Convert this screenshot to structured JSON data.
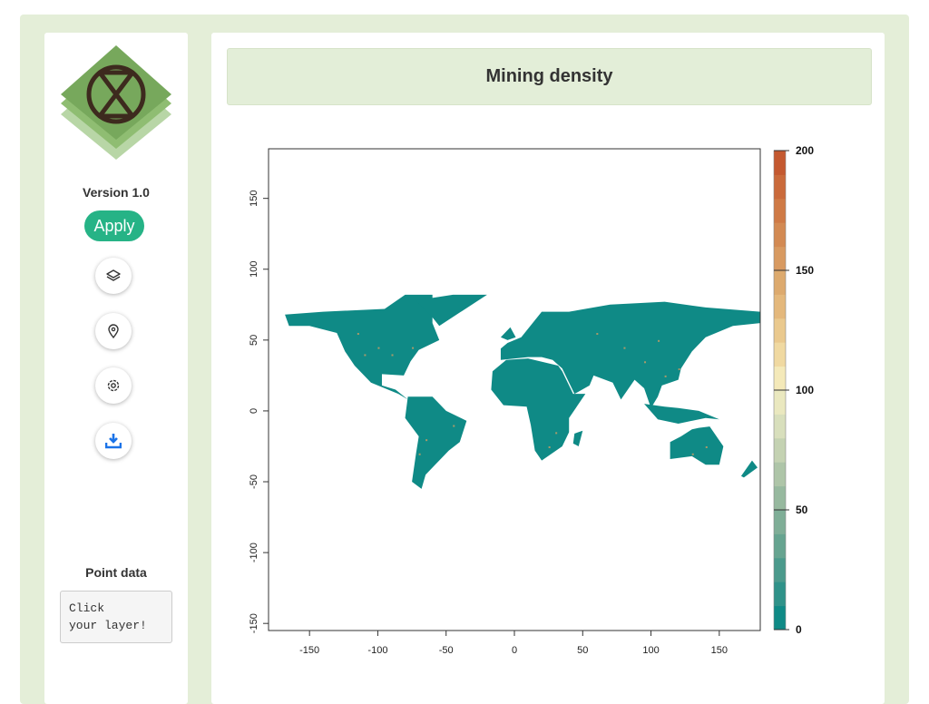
{
  "sidebar": {
    "version": "Version 1.0",
    "apply_label": "Apply",
    "icons": [
      "layers-icon",
      "map-pin-icon",
      "gear-icon",
      "download-icon"
    ],
    "point_data_title": "Point data",
    "point_data_text": "Click\nyour layer!"
  },
  "header": {
    "title": "Mining density"
  },
  "colors": {
    "accent": "#26b386",
    "land": "#0f8a86",
    "bg": "#e4eed8"
  },
  "chart_data": {
    "type": "heatmap",
    "title": "Mining density",
    "xlim": [
      -180,
      180
    ],
    "ylim": [
      -155,
      185
    ],
    "xticks": [
      "-150",
      "-100",
      "-50",
      "0",
      "50",
      "100",
      "150"
    ],
    "yticks": [
      "-150",
      "-100",
      "-50",
      "0",
      "50",
      "100",
      "150"
    ],
    "legend": {
      "min": 0,
      "max": 200,
      "ticks": [
        "0",
        "50",
        "100",
        "150",
        "200"
      ],
      "placement": "right",
      "colors": [
        "#0f8a86",
        "#2f9289",
        "#4b9a8c",
        "#66a490",
        "#7fae97",
        "#97b99f",
        "#aec5a8",
        "#c4d2b2",
        "#d8dfbc",
        "#eae8bf",
        "#f4e9b9",
        "#f0d9a1",
        "#eac98e",
        "#e4b87c",
        "#ddaa6e",
        "#d89a61",
        "#d38a53",
        "#cf7a46",
        "#ca6a3b",
        "#c45930"
      ]
    }
  }
}
